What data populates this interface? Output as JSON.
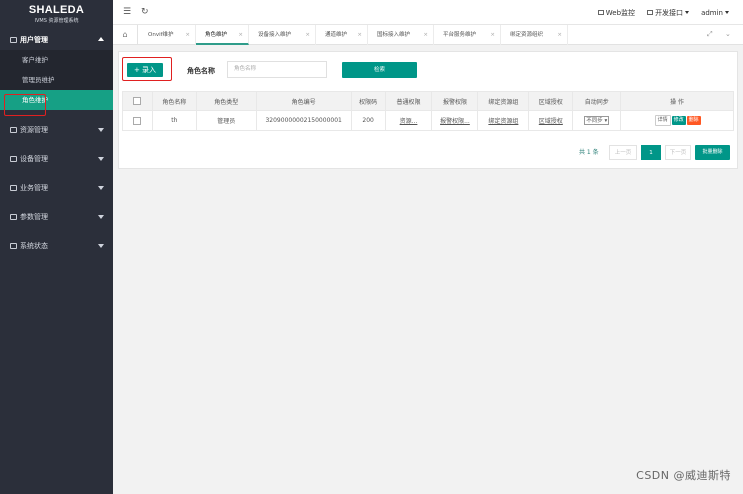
{
  "sidebar": {
    "logo_title": "SHALEDA",
    "logo_subtitle": "IVMS 资源管理系统",
    "groups": [
      {
        "label": "用户管理",
        "icon": "user-icon",
        "open": true,
        "items": [
          {
            "label": "客户维护"
          },
          {
            "label": "管理员维护"
          },
          {
            "label": "角色维护",
            "active": true
          }
        ]
      },
      {
        "label": "资源管理",
        "icon": "folder-icon"
      },
      {
        "label": "设备管理",
        "icon": "device-icon"
      },
      {
        "label": "业务管理",
        "icon": "service-icon"
      },
      {
        "label": "参数管理",
        "icon": "settings-icon"
      },
      {
        "label": "系统状态",
        "icon": "monitor-icon"
      }
    ]
  },
  "header": {
    "menu_icon": "menu-icon",
    "refresh_icon": "refresh-icon",
    "web_monitor": "Web监控",
    "dev_interface": "开发接口",
    "user": "admin"
  },
  "tabs": [
    {
      "label": "Onvif维护"
    },
    {
      "label": "角色维护",
      "active": true
    },
    {
      "label": "设备接入维护"
    },
    {
      "label": "通道维护"
    },
    {
      "label": "国标接入维护"
    },
    {
      "label": "平台服务维护"
    },
    {
      "label": "绑定资源组织"
    }
  ],
  "toolbar": {
    "add_label": "+ 录入",
    "search_label": "角色名称",
    "search_placeholder": "角色名称",
    "search_button": "检索"
  },
  "table": {
    "columns": [
      "角色名称",
      "角色类型",
      "角色编号",
      "权限码",
      "普通权限",
      "报警权限",
      "绑定资源组",
      "区域授权",
      "自动同步",
      "操 作"
    ],
    "rows": [
      {
        "name": "th",
        "type": "管理员",
        "code": "32090000002150000001",
        "perm_code": "200",
        "normal_perm": "资源...",
        "alarm_perm": "报警权限...",
        "bind_group": "绑定资源组",
        "region_auth": "区域授权",
        "auto_sync": "不同步",
        "actions": [
          "详情",
          "修改",
          "删除"
        ]
      }
    ]
  },
  "pagination": {
    "total": "共 1 条",
    "prev": "上一页",
    "current": "1",
    "next": "下一页",
    "batch_delete": "批量删除"
  },
  "watermark": "CSDN @威迪斯特",
  "colors": {
    "sidebar_bg": "#2b2f3a",
    "accent": "#009688",
    "danger": "#ff5722",
    "highlight": "#e02020"
  }
}
